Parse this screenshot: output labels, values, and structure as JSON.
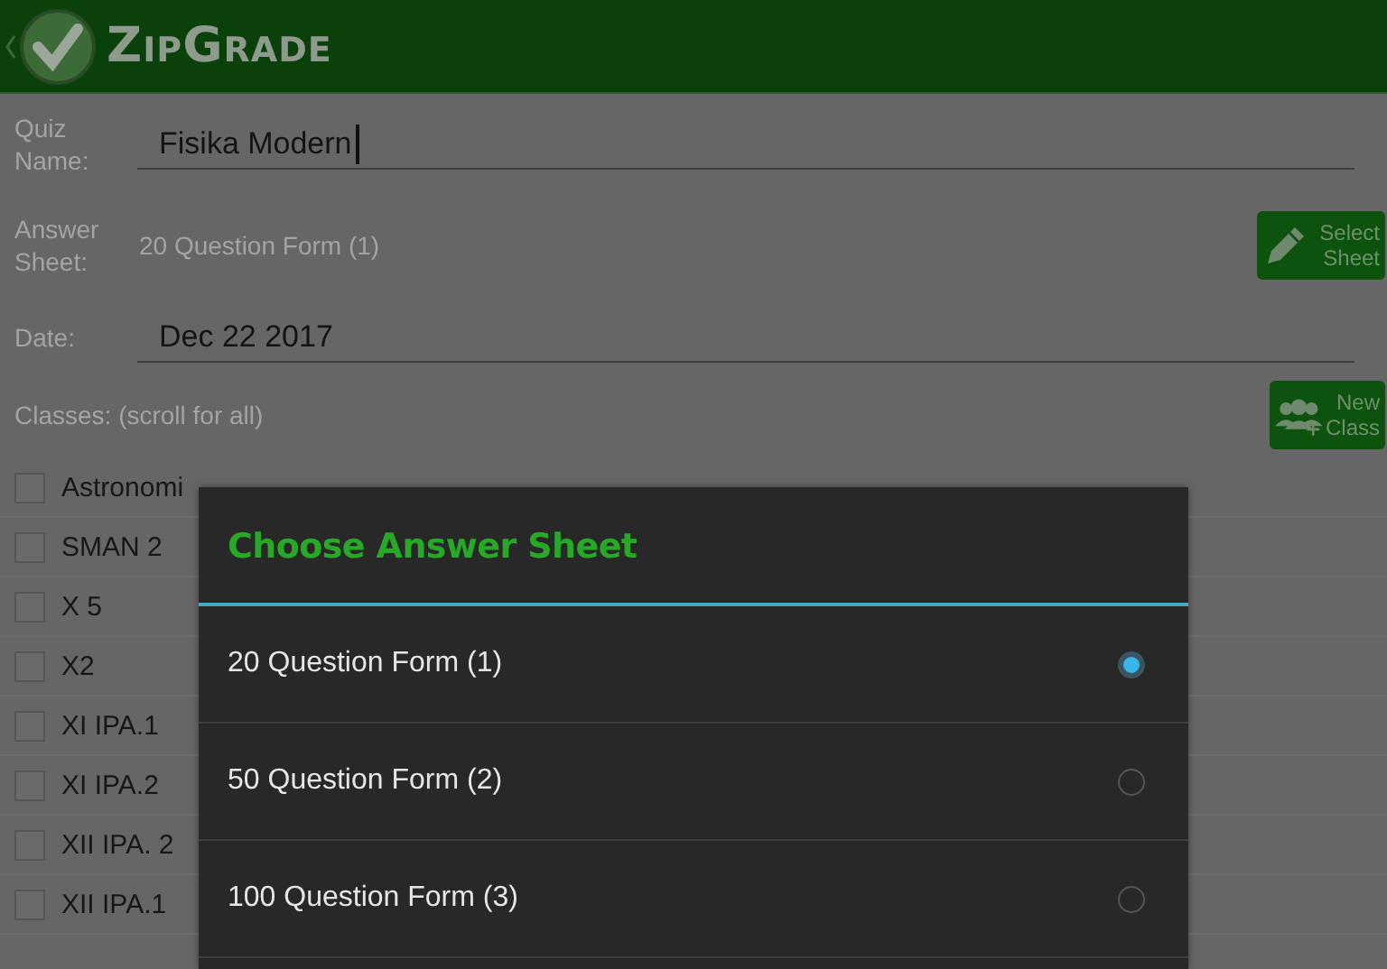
{
  "app_bar": {
    "title": "ZipGrade"
  },
  "quiz_name": {
    "label": "Quiz Name:",
    "value": "Fisika Modern",
    "focused": true
  },
  "answer_sheet": {
    "label": "Answer Sheet:",
    "value": "20 Question Form (1)",
    "button": "Select Sheet"
  },
  "date": {
    "label": "Date:",
    "value": "Dec 22 2017"
  },
  "classes": {
    "label": "Classes: (scroll for all)",
    "button": "New Class",
    "items": [
      {
        "name": "Astronomi",
        "checked": false
      },
      {
        "name": "SMAN 2",
        "checked": false
      },
      {
        "name": "X 5",
        "checked": false
      },
      {
        "name": "X2",
        "checked": false
      },
      {
        "name": "XI IPA.1",
        "checked": false
      },
      {
        "name": "XI IPA.2",
        "checked": false
      },
      {
        "name": "XII IPA. 2",
        "checked": false
      },
      {
        "name": "XII IPA.1",
        "checked": false
      }
    ]
  },
  "dialog": {
    "title": "Choose Answer Sheet",
    "options": [
      {
        "label": "20 Question Form (1)",
        "selected": true
      },
      {
        "label": "50 Question Form (2)",
        "selected": false
      },
      {
        "label": "100 Question Form (3)",
        "selected": false
      }
    ]
  }
}
